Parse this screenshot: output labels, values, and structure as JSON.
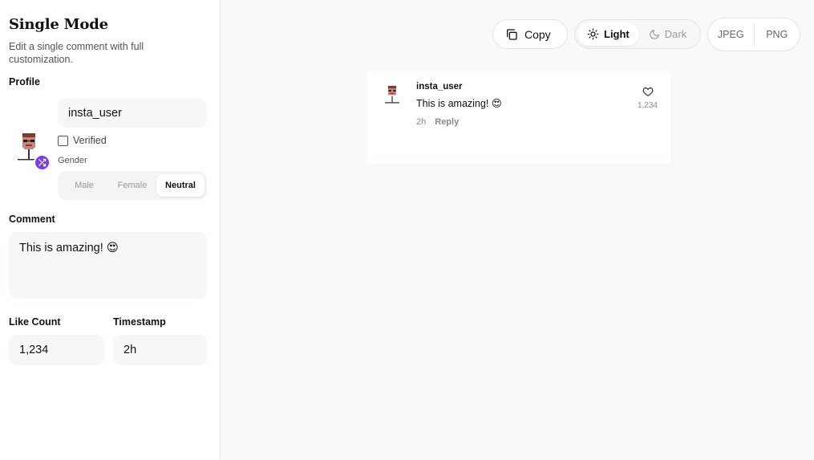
{
  "sidebar": {
    "title": "Single Mode",
    "subtitle": "Edit a single comment with full customization.",
    "profile_label": "Profile",
    "username_value": "insta_user",
    "verified_label": "Verified",
    "gender_label": "Gender",
    "gender_options": [
      "Male",
      "Female",
      "Neutral"
    ],
    "gender_selected": "Neutral",
    "comment_label": "Comment",
    "comment_value": "This is amazing! 😍",
    "like_count_label": "Like Count",
    "like_count_value": "1,234",
    "timestamp_label": "Timestamp",
    "timestamp_value": "2h"
  },
  "toolbar": {
    "copy_label": "Copy",
    "theme_light_label": "Light",
    "theme_dark_label": "Dark",
    "theme_selected": "Light",
    "export_jpeg_label": "JPEG",
    "export_png_label": "PNG"
  },
  "preview": {
    "username": "insta_user",
    "text": "This is amazing! 😍",
    "time": "2h",
    "reply_label": "Reply",
    "likes": "1,234"
  },
  "colors": {
    "accent": "#7c3aed"
  }
}
